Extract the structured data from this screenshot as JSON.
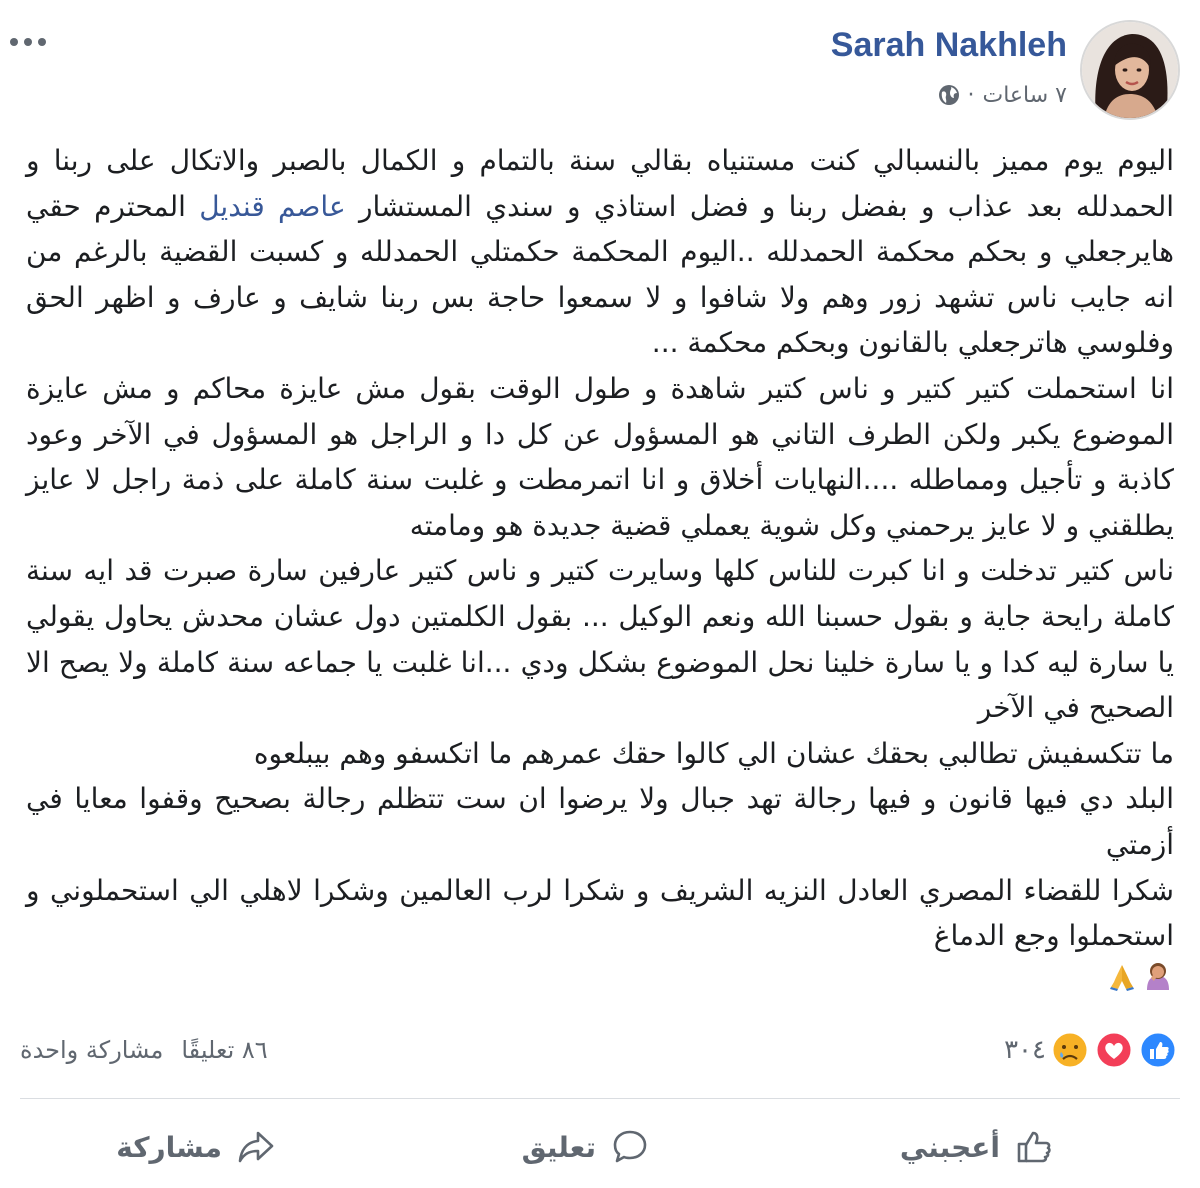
{
  "author": {
    "name": "Sarah Nakhleh"
  },
  "meta": {
    "time": "٧ ساعات",
    "separator": "·"
  },
  "post": {
    "p1_a": "اليوم يوم مميز بالنسبالي كنت مستنياه بقالي سنة بالتمام و الكمال بالصبر والاتكال على ربنا و الحمدلله بعد عذاب و بفضل ربنا و فضل استاذي و سندي المستشار ",
    "mention": "عاصم قنديل",
    "p1_b": " المحترم حقي هايرجعلي و بحكم محكمة الحمدلله ..اليوم المحكمة حكمتلي الحمدلله و كسبت القضية بالرغم من انه جايب ناس تشهد زور وهم ولا شافوا و لا سمعوا حاجة بس ربنا شايف و عارف و اظهر الحق وفلوسي هاترجعلي بالقانون وبحكم محكمة ...",
    "p2": "انا استحملت كتير كتير و ناس كتير شاهدة و طول الوقت بقول مش عايزة محاكم و مش عايزة الموضوع يكبر ولكن الطرف التاني هو المسؤول عن كل دا و الراجل هو المسؤول في الآخر وعود كاذبة و تأجيل ومماطله ....النهايات أخلاق و انا اتمرمطت و غلبت سنة كاملة على ذمة راجل لا عايز يطلقني و لا عايز يرحمني وكل شوية يعملي قضية جديدة هو ومامته",
    "p3": "ناس كتير تدخلت و انا كبرت للناس كلها وسايرت كتير و ناس كتير عارفين سارة صبرت قد ايه سنة كاملة رايحة جاية و بقول حسبنا الله ونعم الوكيل ... بقول الكلمتين دول عشان محدش يحاول يقولي يا سارة ليه كدا و يا سارة خلينا نحل الموضوع بشكل ودي ...انا غلبت يا جماعه سنة كاملة ولا يصح الا الصحيح في الآخر",
    "p4": "ما تتكسفيش تطالبي بحقك عشان الي كالوا حقك عمرهم ما اتكسفو وهم بيبلعوه",
    "p5": "البلد دي فيها قانون و فيها رجالة تهد جبال ولا يرضوا ان ست تتظلم رجالة بصحيح وقفوا معايا في أزمتي",
    "p6": "شكرا للقضاء المصري العادل النزيه الشريف و شكرا لرب العالمين وشكرا لاهلي الي استحملوني و استحملوا وجع الدماغ",
    "emojis": [
      "woman-facepalming-icon",
      "folded-hands-icon"
    ]
  },
  "reactions": {
    "count": "٣٠٤",
    "types": [
      "like-icon",
      "love-icon",
      "sad-icon"
    ],
    "colors": {
      "like": "#2d88ff",
      "love": "#f33e58",
      "sad": "#f7b125"
    }
  },
  "stats": {
    "comments": "٨٦ تعليقًا",
    "shares": "مشاركة واحدة"
  },
  "actions": {
    "like": "أعجبني",
    "comment": "تعليق",
    "share": "مشاركة"
  }
}
